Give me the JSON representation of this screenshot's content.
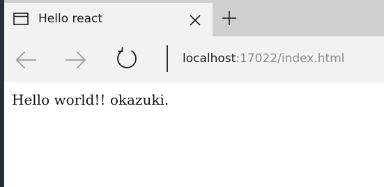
{
  "tab": {
    "title": "Hello react",
    "favicon_icon": "window-icon",
    "close_icon": "close-icon"
  },
  "new_tab_icon": "plus-icon",
  "toolbar": {
    "back_icon": "arrow-left-icon",
    "forward_icon": "arrow-right-icon",
    "refresh_icon": "refresh-icon",
    "address": {
      "host": "localhost",
      "rest": ":17022/index.html"
    }
  },
  "page": {
    "text": "Hello world!! okazuki."
  },
  "colors": {
    "tab_active": "#f2f2f2",
    "tabstrip": "#cfcfcf",
    "address_host": "#1a1a1a",
    "address_rest": "#8a8a8a",
    "nav_disabled": "#9a9a9a"
  }
}
